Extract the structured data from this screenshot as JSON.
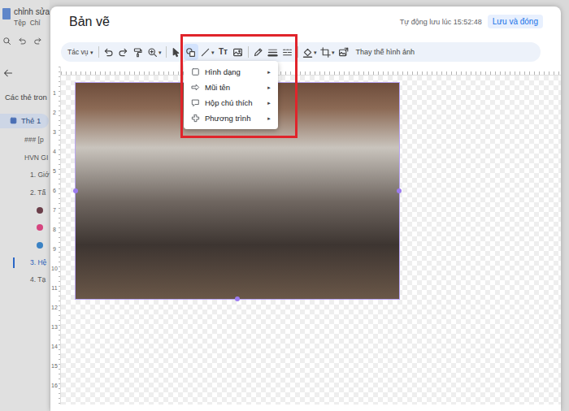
{
  "docs": {
    "title": "chỉnh sửa",
    "menus": [
      "Tệp",
      "Chỉ"
    ]
  },
  "sidebar": {
    "heading": "Các thẻ tron",
    "tab": {
      "label": "Thẻ 1",
      "selected": true
    },
    "outline": [
      {
        "kind": "title",
        "label": "### [p",
        "selected": false
      },
      {
        "kind": "title",
        "label": "HVN GI",
        "selected": false
      },
      {
        "kind": "text",
        "label": "1. Giớ",
        "selected": false
      },
      {
        "kind": "text",
        "label": "2. Tấ",
        "selected": false
      },
      {
        "kind": "dot",
        "color": "#6b3f4a",
        "selected": false
      },
      {
        "kind": "dot",
        "color": "#d6457f",
        "selected": false
      },
      {
        "kind": "dot",
        "color": "#3b82c4",
        "selected": false
      },
      {
        "kind": "text",
        "label": "3. Hệ",
        "selected": true
      },
      {
        "kind": "text",
        "label": "4. Tạ",
        "selected": false
      }
    ]
  },
  "dialog": {
    "title": "Bản vẽ",
    "autosave": "Tự động lưu lúc 15:52:48",
    "save": "Lưu và đóng"
  },
  "toolbar": {
    "actions": {
      "label": "Tác vụ",
      "caret": "▾"
    },
    "tools": [
      {
        "kind": "undo",
        "selected": false
      },
      {
        "kind": "redo",
        "selected": false
      },
      {
        "kind": "paint",
        "selected": false
      },
      {
        "kind": "zoom",
        "selected": false,
        "caret": "▾"
      },
      {
        "kind": "separator"
      },
      {
        "kind": "select",
        "selected": false
      },
      {
        "kind": "shape",
        "selected": true
      },
      {
        "kind": "line",
        "selected": false,
        "caret": "▾"
      },
      {
        "kind": "textbox",
        "selected": false,
        "glyph": "Tт"
      },
      {
        "kind": "image",
        "selected": false
      },
      {
        "kind": "separator"
      },
      {
        "kind": "pen",
        "selected": false
      },
      {
        "kind": "weight",
        "selected": false
      },
      {
        "kind": "dash",
        "selected": false
      },
      {
        "kind": "separator"
      },
      {
        "kind": "fill",
        "selected": false,
        "caret": "▾"
      },
      {
        "kind": "crop",
        "selected": false,
        "caret": "▾"
      },
      {
        "kind": "replace",
        "selected": false
      }
    ],
    "replace_image": "Thay thế hình ảnh"
  },
  "shape_menu": {
    "open": true,
    "highlighted": true,
    "items": [
      {
        "kind": "shape",
        "label": "Hình dạng",
        "arrow": "►"
      },
      {
        "kind": "arrow",
        "label": "Mũi tên",
        "arrow": "►"
      },
      {
        "kind": "callout",
        "label": "Hộp chú thích",
        "arrow": "►"
      },
      {
        "kind": "equation",
        "label": "Phương trình",
        "arrow": "►"
      }
    ]
  },
  "ruler": {
    "left": [
      "1",
      "2",
      "3",
      "4",
      "5",
      "6",
      "7",
      "8",
      "9",
      "10",
      "11",
      "12",
      "13",
      "14",
      "15",
      "16"
    ]
  },
  "canvas": {
    "image": {
      "selected": true
    }
  }
}
